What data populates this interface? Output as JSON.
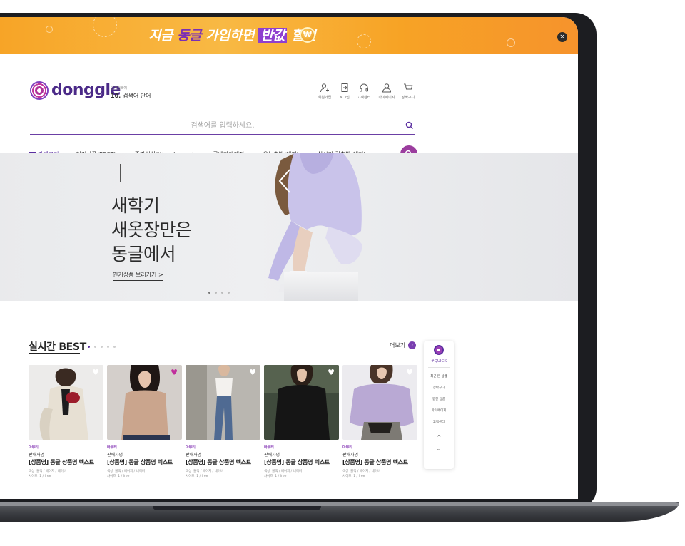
{
  "promo": {
    "text_prefix": "지금 ",
    "text_highlight1": "동글",
    "text_middle": " 가입하면 ",
    "text_highlight2": "반값",
    "text_suffix": " 할인",
    "coin_symbol": "₩",
    "close_icon": "×",
    "colors": {
      "background": "#f7a325",
      "highlight1": "#7a2fb5",
      "highlight2_bg": "#8f3fcf"
    }
  },
  "header": {
    "logo_text": "donggle",
    "rank_caption": "인기검색어",
    "rank_number": "10.",
    "rank_keyword": "검색어 단어",
    "utility_icons": [
      {
        "icon": "user-plus-icon",
        "label": "회원가입"
      },
      {
        "icon": "login-icon",
        "label": "로그인"
      },
      {
        "icon": "headset-icon",
        "label": "고객센터"
      },
      {
        "icon": "user-icon",
        "label": "마이페이지"
      },
      {
        "icon": "cart-icon",
        "label": "장바구니"
      }
    ],
    "search_placeholder": "검색어를 입력하세요.",
    "category_label": "카테고리",
    "nav_items": [
      "인기상품(BEST)",
      "주간신상(Weekly new)",
      "국내자체제작",
      "오늘출발(예정)",
      "실시간 퀵출발(예정)"
    ],
    "accent_color": "#5b2fa0"
  },
  "hero": {
    "title": "새학기\n새옷장만은\n동글에서",
    "link_text": "인기상품 보러가기 >",
    "dots": 4,
    "active_dot": 0
  },
  "best": {
    "title": "실시간 BEST",
    "more_label": "더보기",
    "more_icon": "›",
    "dots": 5,
    "active_dot": 0,
    "products": [
      {
        "brand": "아무티",
        "seller": "판매자명",
        "name": "[상품명] 동글 상품명 텍스트",
        "color_label": "색상",
        "colors": "블랙 / 베이지 / 네이비",
        "size_label": "사이즈",
        "size": "1 / free",
        "liked": false
      },
      {
        "brand": "아무티",
        "seller": "판매자명",
        "name": "[상품명] 동글 상품명 텍스트",
        "color_label": "색상",
        "colors": "블랙 / 베이지 / 네이비",
        "size_label": "사이즈",
        "size": "1 / free",
        "liked": true
      },
      {
        "brand": "아무티",
        "seller": "판매자명",
        "name": "[상품명] 동글 상품명 텍스트",
        "color_label": "색상",
        "colors": "블랙 / 베이지 / 네이비",
        "size_label": "사이즈",
        "size": "1 / free",
        "liked": false
      },
      {
        "brand": "아무티",
        "seller": "판매자명",
        "name": "[상품명] 동글 상품명 텍스트",
        "color_label": "색상",
        "colors": "블랙 / 베이지 / 네이비",
        "size_label": "사이즈",
        "size": "1 / free",
        "liked": false
      },
      {
        "brand": "아무티",
        "seller": "판매자명",
        "name": "[상품명] 동글 상품명 텍스트",
        "color_label": "색상",
        "colors": "블랙 / 베이지 / 네이비",
        "size_label": "사이즈",
        "size": "1 / free",
        "liked": false
      }
    ]
  },
  "quick": {
    "title": "#QUICK",
    "items": [
      "최근 본 상품",
      "장바구니",
      "찜한 상품",
      "마이페이지",
      "고객센터"
    ],
    "up_icon": "^",
    "down_icon": "⌄"
  }
}
